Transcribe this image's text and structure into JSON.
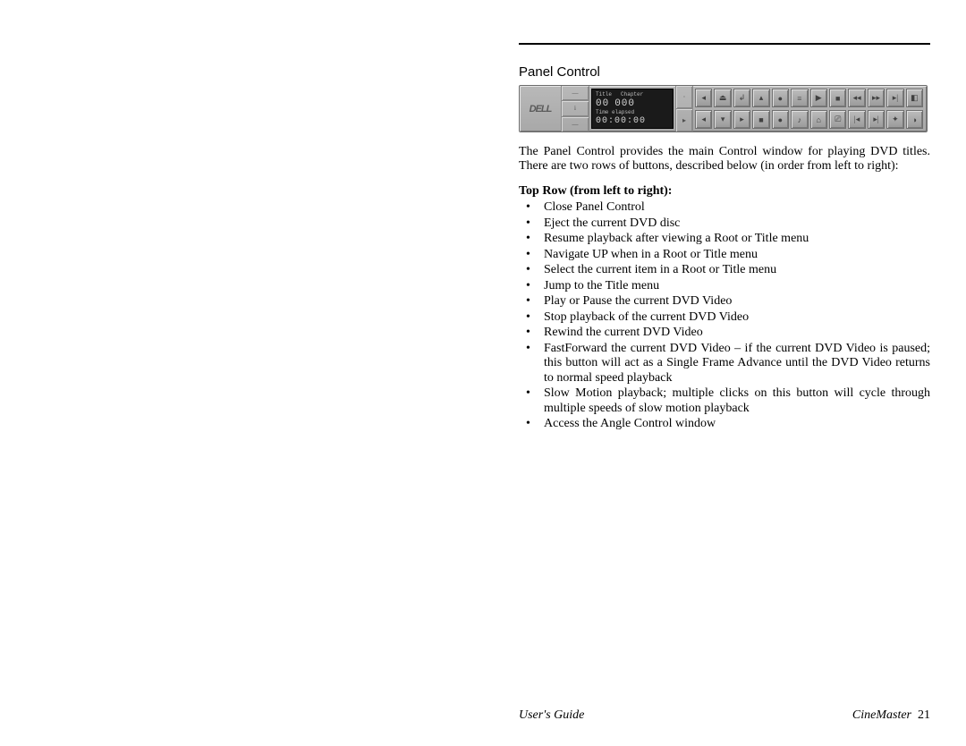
{
  "section_title": "Panel Control",
  "panel": {
    "logo": "DELL",
    "label_title": "Title",
    "label_chapter": "Chapter",
    "title_digits": "00",
    "chapter_digits": "000",
    "label_elapsed": "Time elapsed",
    "elapsed_digits": "00:00:00"
  },
  "intro": "The Panel Control provides the main Control window for playing DVD titles.  There are two rows of buttons, described below (in order from left to right):",
  "subhead": "Top Row (from left to right):",
  "bullets": [
    "Close Panel Control",
    "Eject the current DVD disc",
    "Resume playback after viewing a Root or Title menu",
    "Navigate UP when in a Root or Title menu",
    "Select the current item in a Root or Title menu",
    "Jump to the Title menu",
    "Play or Pause the current DVD Video",
    "Stop playback of the current DVD Video",
    "Rewind the current DVD Video",
    "FastForward the current DVD Video – if the current DVD Video is paused; this button will act as a Single Frame Advance until the DVD Video returns to normal speed playback",
    "Slow Motion playback; multiple clicks on this button will cycle through multiple speeds of slow motion playback",
    "Access the Angle Control window"
  ],
  "footer": {
    "left": "User's Guide",
    "right_label": "CineMaster",
    "page_num": "21"
  }
}
